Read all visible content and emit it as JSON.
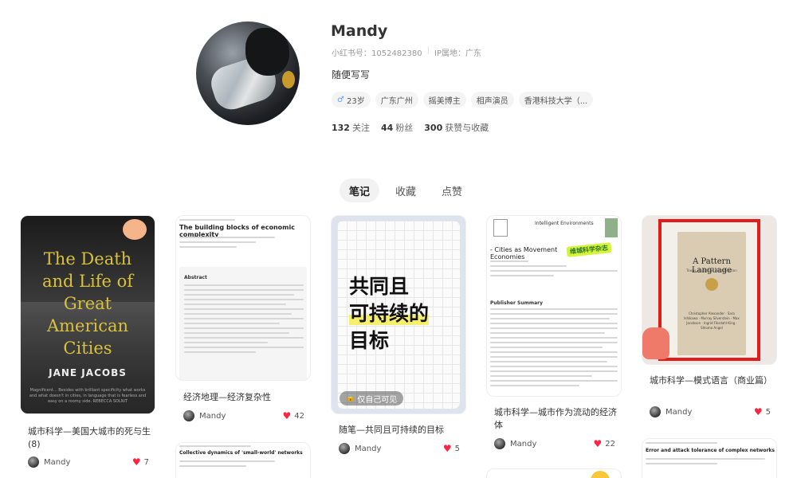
{
  "profile": {
    "name": "Mandy",
    "id_label": "小红书号：1052482380",
    "ip_label": "IP属地：广东",
    "bio": "随便写写",
    "tags": [
      "23岁",
      "广东广州",
      "摇美博主",
      "相声演员",
      "香港科技大学（..."
    ],
    "stats": [
      {
        "num": "132",
        "label": "关注"
      },
      {
        "num": "44",
        "label": "粉丝"
      },
      {
        "num": "300",
        "label": "获赞与收藏"
      }
    ]
  },
  "tabs": [
    "笔记",
    "收藏",
    "点赞"
  ],
  "cards": [
    {
      "title": "城市科学—美国大城市的死与生(8)",
      "author": "Mandy",
      "likes": "7",
      "cover": {
        "title": "The Death and Life of Great American Cities",
        "author": "JANE JACOBS",
        "quote": "Magnificent... Besides with brilliant specificity what works and what doesn't in cities, in language that is fearless and easy on a roomy side. REBECCA SOLNIT"
      }
    },
    {
      "title": "经济地理—经济复杂性",
      "author": "Mandy",
      "likes": "42",
      "cover": {
        "heading": "The building blocks of economic complexity",
        "section": "Abstract"
      }
    },
    {
      "title": "随笔—共同且可持续的目标",
      "author": "Mandy",
      "likes": "5",
      "cover": {
        "line1": "共同且",
        "line2": "可持续的",
        "line3": "目标",
        "privacy": "仅自己可见"
      }
    },
    {
      "title": "城市科学—城市作为流动的经济体",
      "author": "Mandy",
      "likes": "22",
      "cover": {
        "journal": "Intelligent Environments",
        "heading": "- Cities as Movement Economies",
        "section": "Publisher Summary",
        "sticker": "维城科学杂志"
      }
    },
    {
      "title": "城市科学—模式语言（商业篇）",
      "author": "Mandy",
      "likes": "5",
      "cover": {
        "title": "A Pattern Language",
        "subtitle": "Towns · Buildings · Construction",
        "authors": "Christopher Alexander · Sara Ishikawa · Murray Silverstein · Max Jacobson · Ingrid Fiksdahl-King · Shlomo Angel"
      }
    },
    {
      "cover": {
        "heading": "Collective dynamics of 'small-world' networks"
      }
    },
    {
      "cover": {
        "heading": "Error and attack tolerance of complex networks"
      }
    }
  ],
  "colors": {
    "accent": "#ff2442",
    "highlight": "#f5ef6b",
    "frame": "#e21b1b"
  }
}
